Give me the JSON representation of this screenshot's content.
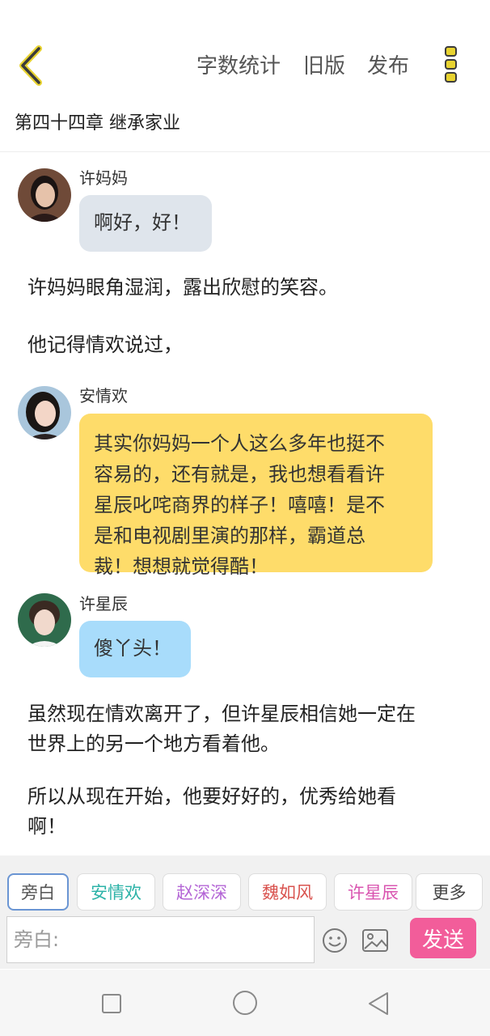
{
  "header": {
    "back_icon": "chevron-left-icon",
    "word_count_label": "字数统计",
    "old_version_label": "旧版",
    "publish_label": "发布",
    "more_icon": "vertical-dots-icon",
    "accent_color": "#e8d330"
  },
  "chapter": {
    "title": "第四十四章 继承家业"
  },
  "messages": [
    {
      "type": "dialogue",
      "speaker": "许妈妈",
      "text": "啊好，好！",
      "bubble_color": "#dfe5ec"
    },
    {
      "type": "narration",
      "text": "许妈妈眼角湿润，露出欣慰的笑容。"
    },
    {
      "type": "narration",
      "text": "他记得情欢说过，"
    },
    {
      "type": "dialogue",
      "speaker": "安情欢",
      "lines": [
        "其实你妈妈一个人这么多年也挺不",
        "容易的，还有就是，我也想看看许",
        "星辰叱咤商界的样子！嘻嘻！是不",
        "是和电视剧里演的那样，霸道总",
        "裁！想想就觉得酷！"
      ],
      "bubble_color": "#fedc6a"
    },
    {
      "type": "dialogue",
      "speaker": "许星辰",
      "text": "傻丫头！",
      "bubble_color": "#a8dcfb"
    },
    {
      "type": "narration",
      "lines": [
        "虽然现在情欢离开了，但许星辰相信她一定在",
        "世界上的另一个地方看着他。"
      ]
    },
    {
      "type": "narration",
      "lines": [
        "所以从现在开始，他要好好的，优秀给她看",
        "啊！"
      ]
    }
  ],
  "role_chips": [
    {
      "label": "旁白",
      "color": "#555555",
      "selected": true
    },
    {
      "label": "安情欢",
      "color": "#2db3a8"
    },
    {
      "label": "赵深深",
      "color": "#b466d6"
    },
    {
      "label": "魏如风",
      "color": "#d9534f"
    },
    {
      "label": "许星辰",
      "color": "#d955b0"
    },
    {
      "label": "更多",
      "color": "#444444"
    }
  ],
  "composer": {
    "placeholder": "旁白:",
    "emoji_icon": "smiley-icon",
    "image_icon": "image-icon",
    "send_label": "发送",
    "send_color": "#f25d9a"
  },
  "navbar": {
    "icons": [
      "square-icon",
      "circle-icon",
      "triangle-back-icon"
    ]
  }
}
